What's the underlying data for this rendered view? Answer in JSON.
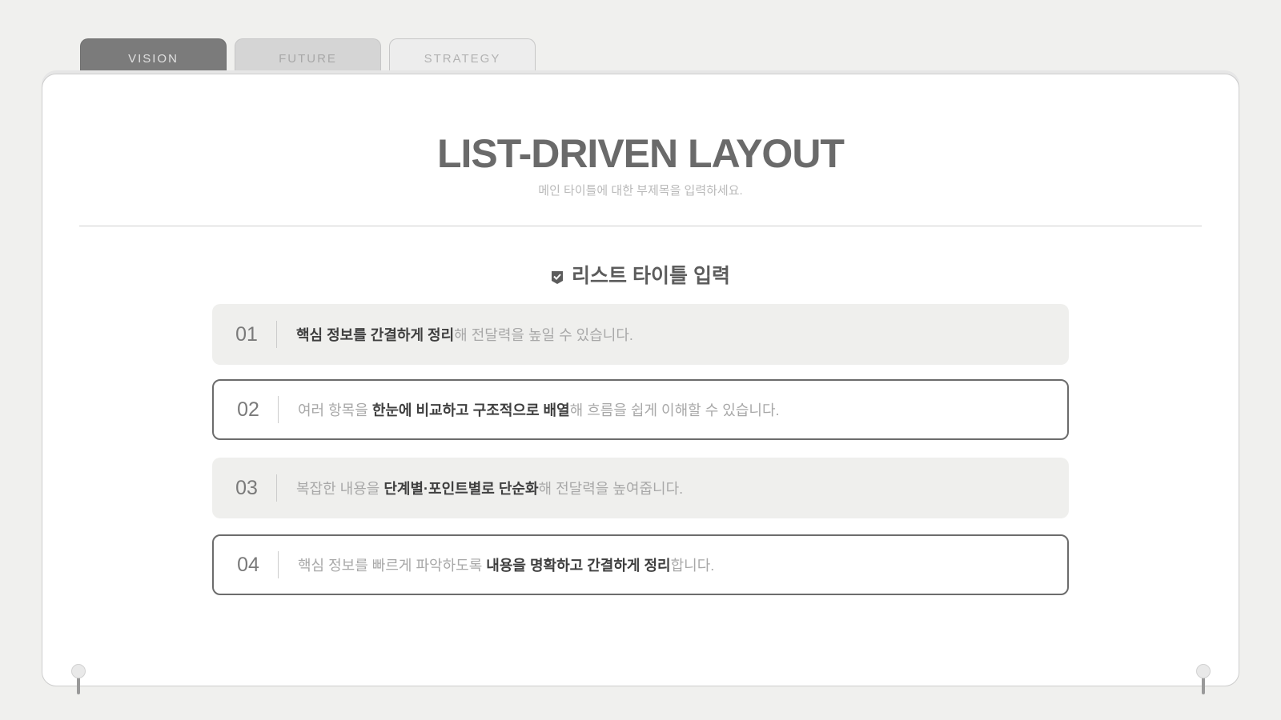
{
  "tabs": [
    "VISION",
    "FUTURE",
    "STRATEGY"
  ],
  "header": {
    "title": "LIST-DRIVEN LAYOUT",
    "subtitle": "메인 타이틀에 대한 부제목을 입력하세요."
  },
  "list": {
    "title": "리스트 타이틀 입력",
    "title_icon": "check-badge-icon",
    "items": [
      {
        "num": "01",
        "pre": "",
        "bold": "핵심 정보를 간결하게 정리",
        "post": "해 전달력을 높일 수 있습니다."
      },
      {
        "num": "02",
        "pre": "여러 항목을 ",
        "bold": "한눈에 비교하고 구조적으로 배열",
        "post": "해 흐름을 쉽게 이해할 수 있습니다."
      },
      {
        "num": "03",
        "pre": "복잡한 내용을 ",
        "bold": "단계별·포인트별로 단순화",
        "post": "해 전달력을 높여줍니다."
      },
      {
        "num": "04",
        "pre": "핵심 정보를 빠르게 파악하도록 ",
        "bold": "내용을 명확하고 간결하게 정리",
        "post": "합니다."
      }
    ]
  },
  "colors": {
    "background": "#f0f0ee",
    "active_tab": "#7b7b7b",
    "title": "#6a6a6a",
    "item_fill": "#efefed",
    "item_border": "#6c6c6c"
  }
}
